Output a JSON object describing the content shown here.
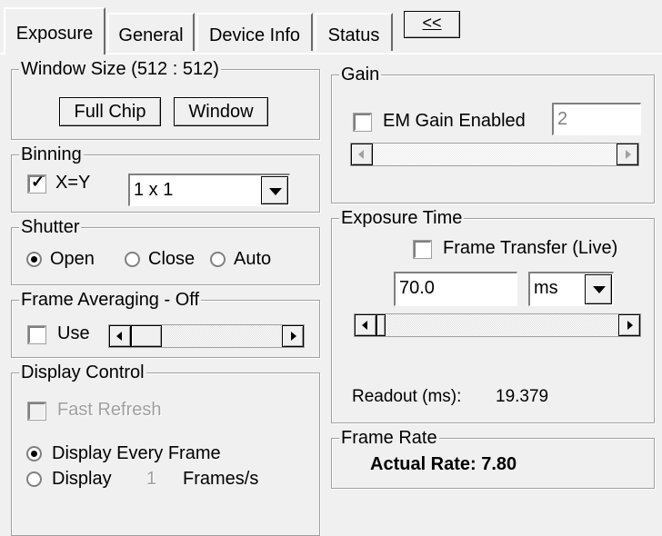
{
  "tabs": [
    {
      "label": "Exposure",
      "active": true
    },
    {
      "label": "General",
      "active": false
    },
    {
      "label": "Device Info",
      "active": false
    },
    {
      "label": "Status",
      "active": false
    }
  ],
  "collapse_button": {
    "label": "<<"
  },
  "window_size": {
    "title": "Window Size (512 : 512)",
    "full_chip_label": "Full Chip",
    "window_label": "Window"
  },
  "binning": {
    "title": "Binning",
    "xy_label": "X=Y",
    "xy_checked": true,
    "selected": "1 x 1"
  },
  "shutter": {
    "title": "Shutter",
    "options": [
      "Open",
      "Close",
      "Auto"
    ],
    "selected": "Open"
  },
  "frame_averaging": {
    "title": "Frame Averaging - Off",
    "use_label": "Use",
    "use_checked": false
  },
  "display_control": {
    "title": "Display Control",
    "fast_refresh_label": "Fast Refresh",
    "fast_refresh_enabled": false,
    "every_frame_label": "Display Every Frame",
    "display_label": "Display",
    "display_value": "1",
    "frames_per_s_label": "Frames/s",
    "selected": "Display Every Frame"
  },
  "gain": {
    "title": "Gain",
    "em_gain_label": "EM Gain Enabled",
    "em_gain_checked": false,
    "em_gain_value": "2"
  },
  "exposure_time": {
    "title": "Exposure Time",
    "frame_transfer_label": "Frame Transfer (Live)",
    "frame_transfer_checked": false,
    "value": "70.0",
    "unit": "ms",
    "readout_label": "Readout (ms):",
    "readout_value": "19.379"
  },
  "frame_rate": {
    "title": "Frame Rate",
    "actual_rate": "Actual Rate: 7.80"
  }
}
